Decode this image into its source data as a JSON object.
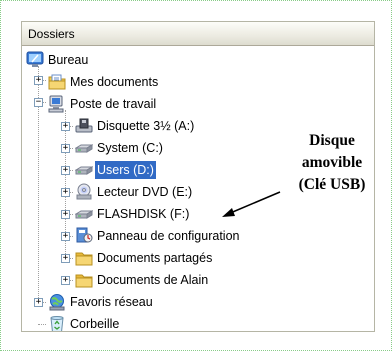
{
  "pane": {
    "title": "Dossiers"
  },
  "tree": {
    "bureau": {
      "label": "Bureau",
      "icon": "desktop-icon"
    },
    "mes_documents": {
      "label": "Mes documents",
      "icon": "folder-documents-icon",
      "expander": "+"
    },
    "poste_de_travail": {
      "label": "Poste de travail",
      "icon": "computer-icon",
      "expander": "−"
    },
    "disquette": {
      "label": "Disquette 3½ (A:)",
      "icon": "floppy-icon",
      "expander": "+"
    },
    "system": {
      "label": "System (C:)",
      "icon": "hard-drive-icon",
      "expander": "+"
    },
    "users": {
      "label": "Users (D:)",
      "icon": "hard-drive-icon",
      "expander": "+",
      "selected": true
    },
    "lecteur_dvd": {
      "label": "Lecteur DVD (E:)",
      "icon": "dvd-icon",
      "expander": "+"
    },
    "flashdisk": {
      "label": "FLASHDISK (F:)",
      "icon": "usb-drive-icon",
      "expander": "+"
    },
    "panneau": {
      "label": "Panneau de configuration",
      "icon": "control-panel-icon",
      "expander": "+"
    },
    "documents_partages": {
      "label": "Documents partagés",
      "icon": "folder-icon",
      "expander": "+"
    },
    "documents_alain": {
      "label": "Documents de Alain",
      "icon": "folder-icon",
      "expander": "+"
    },
    "favoris_reseau": {
      "label": "Favoris réseau",
      "icon": "network-icon",
      "expander": "+"
    },
    "corbeille": {
      "label": "Corbeille",
      "icon": "recycle-bin-icon"
    }
  },
  "annotation": {
    "line1": "Disque",
    "line2": "amovible",
    "line3": "(Clé USB)"
  },
  "colors": {
    "selection": "#316ac5",
    "folder": "#f2c94c",
    "border": "#b5b5a5"
  }
}
